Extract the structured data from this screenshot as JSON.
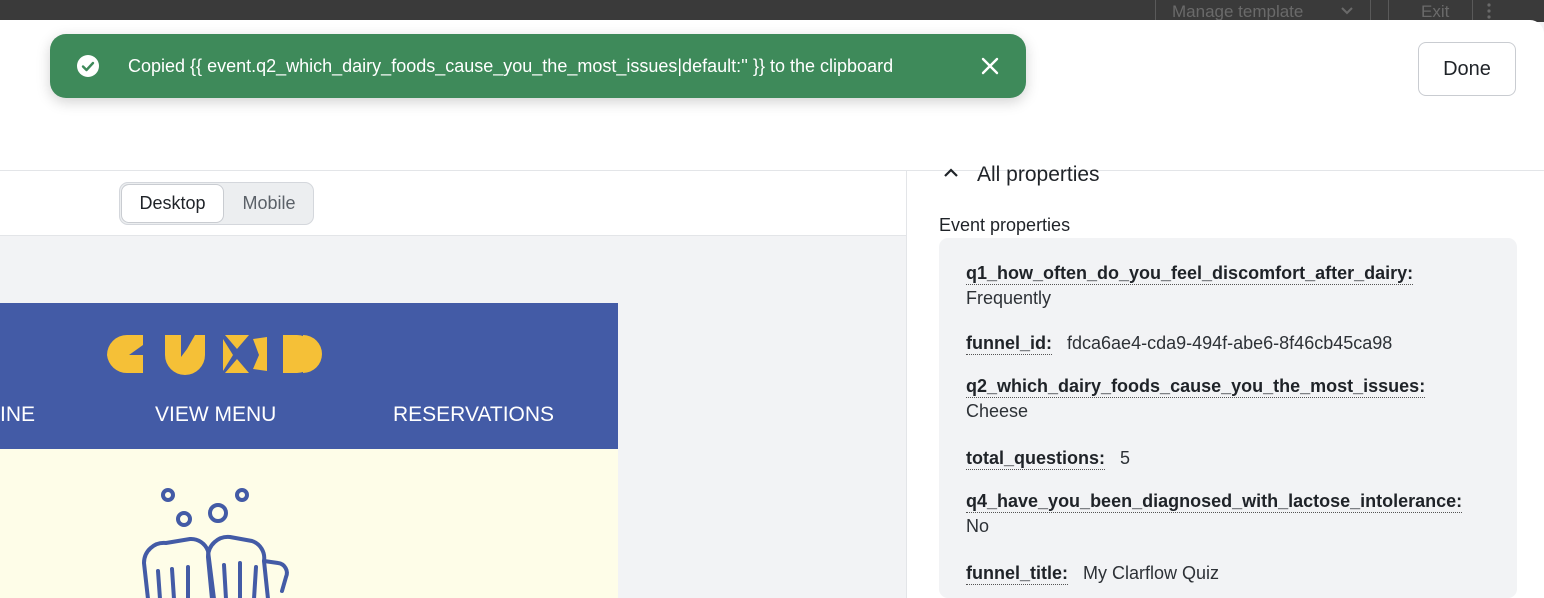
{
  "topbar": {
    "manage_label": "Manage template",
    "exit_label": "Exit"
  },
  "header": {
    "done_label": "Done"
  },
  "toast": {
    "message": "Copied {{ event.q2_which_dairy_foods_cause_you_the_most_issues|default:'' }} to the clipboard",
    "color": "#3e8a5a"
  },
  "preview": {
    "view_toggle": {
      "desktop": "Desktop",
      "mobile": "Mobile",
      "selected": "Desktop"
    },
    "email": {
      "nav_color": "#435ba6",
      "logo_color": "#f5c037",
      "nav_links": [
        "INE",
        "VIEW MENU",
        "RESERVATIONS"
      ],
      "body_color": "#fefde8"
    }
  },
  "properties": {
    "section_title": "All properties",
    "event_label": "Event properties",
    "items": [
      {
        "key": "q1_how_often_do_you_feel_discomfort_after_dairy:",
        "value": "Frequently"
      },
      {
        "key": "funnel_id:",
        "value": "fdca6ae4-cda9-494f-abe6-8f46cb45ca98"
      },
      {
        "key": "q2_which_dairy_foods_cause_you_the_most_issues:",
        "value": "Cheese"
      },
      {
        "key": "total_questions:",
        "value": "5"
      },
      {
        "key": "q4_have_you_been_diagnosed_with_lactose_intolerance:",
        "value": "No"
      },
      {
        "key": "funnel_title:",
        "value": "My Clarflow Quiz"
      }
    ]
  }
}
